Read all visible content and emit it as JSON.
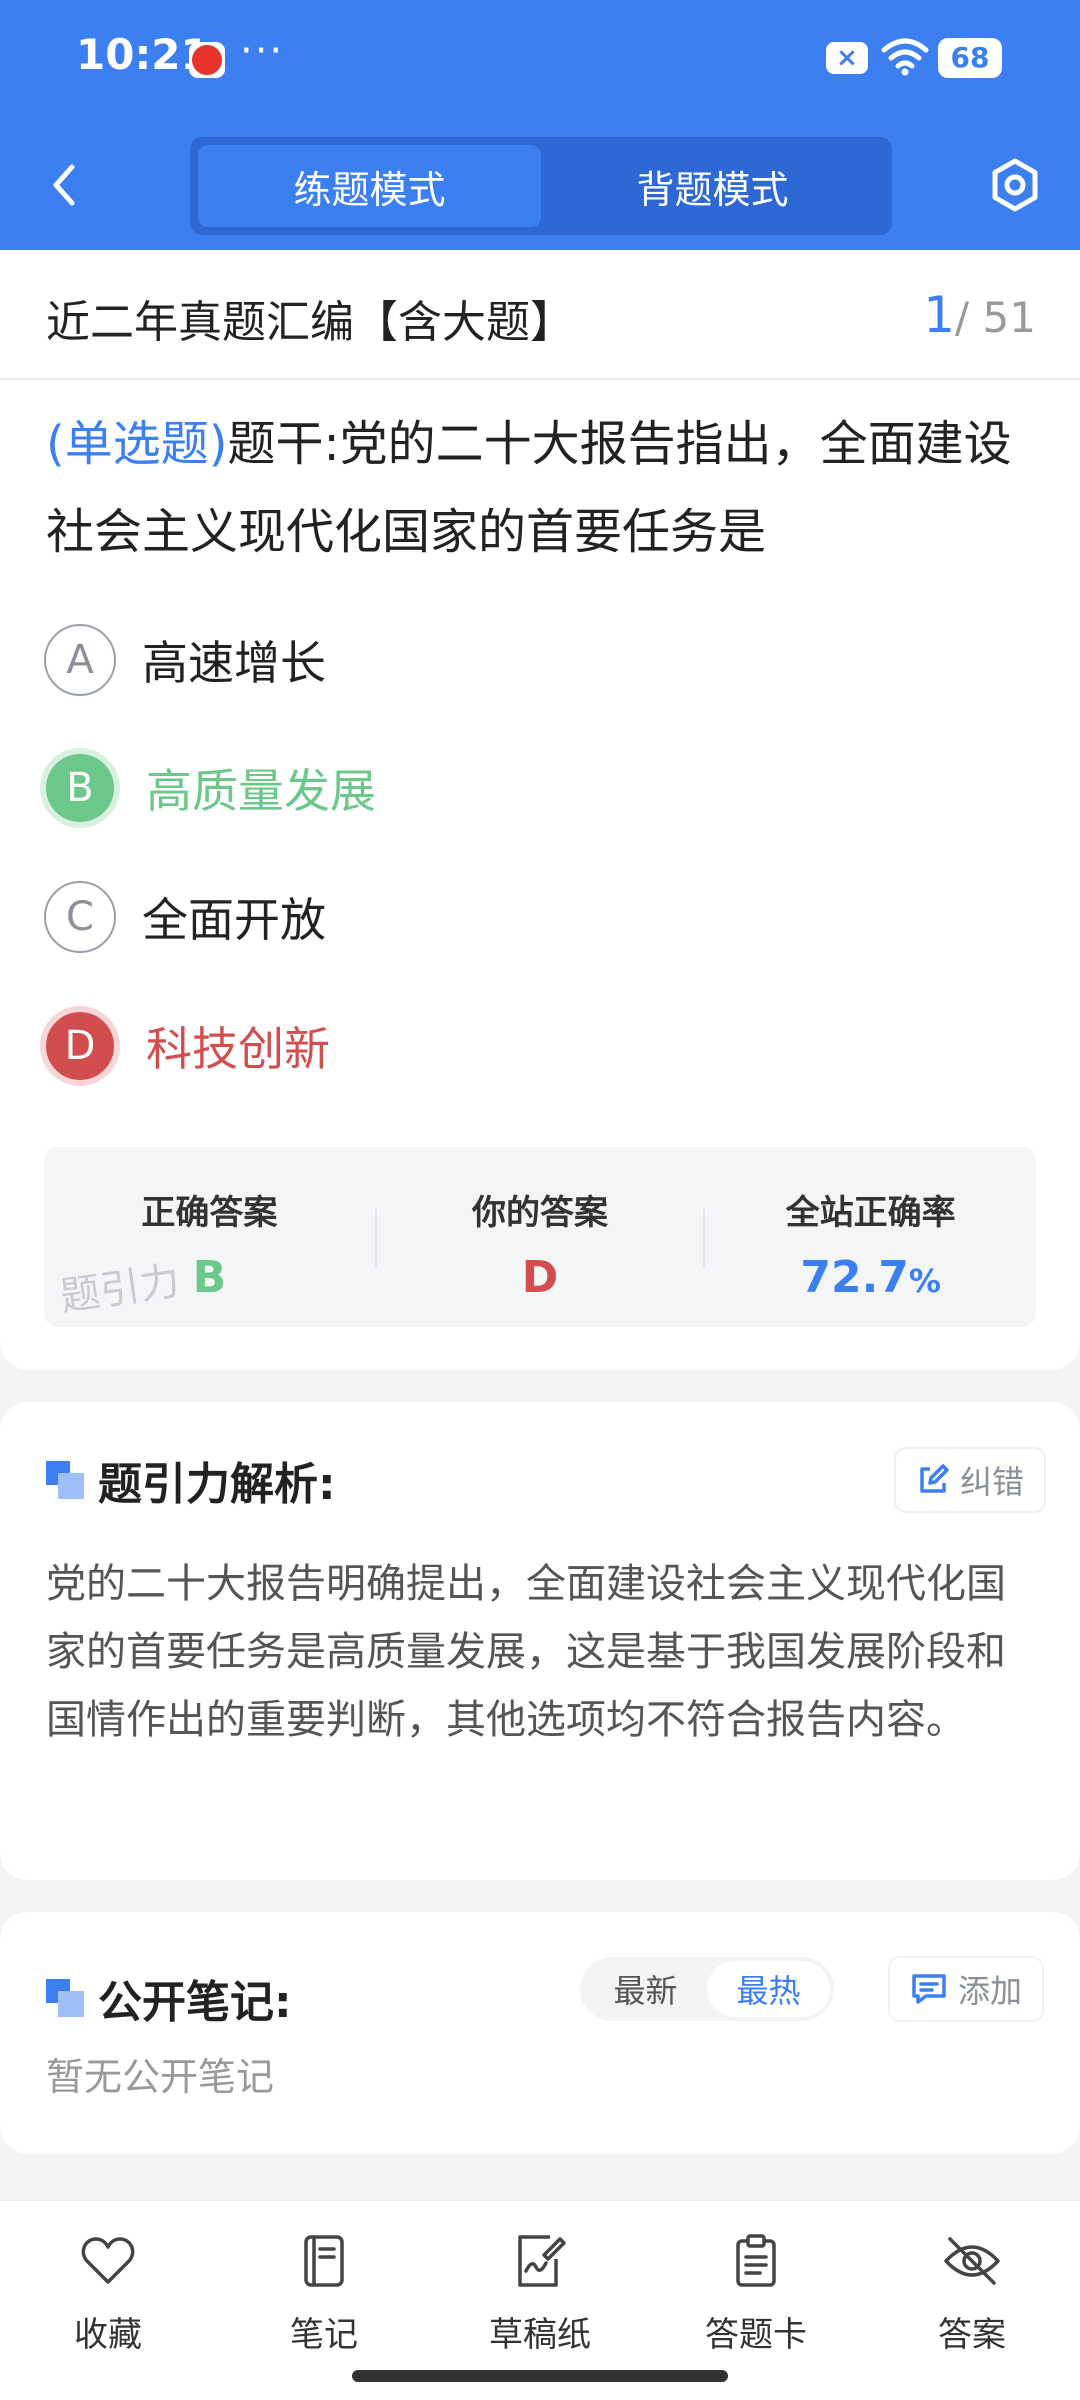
{
  "status_bar": {
    "time": "10:21",
    "more": "···",
    "battery": "68"
  },
  "header": {
    "modes": [
      "练题模式",
      "背题模式"
    ],
    "active_mode": "练题模式"
  },
  "exam": {
    "title": "近二年真题汇编【含大题】",
    "current": "1",
    "total": "/ 51"
  },
  "question": {
    "type": "(单选题)",
    "stem": "题干:党的二十大报告指出，全面建设社会主义现代化国家的首要任务是",
    "options": [
      {
        "letter": "A",
        "text": "高速增长",
        "state": "normal"
      },
      {
        "letter": "B",
        "text": "高质量发展",
        "state": "correct"
      },
      {
        "letter": "C",
        "text": "全面开放",
        "state": "normal"
      },
      {
        "letter": "D",
        "text": "科技创新",
        "state": "wrong"
      }
    ]
  },
  "result": {
    "correct_label": "正确答案",
    "correct_value": "B",
    "yours_label": "你的答案",
    "yours_value": "D",
    "rate_label": "全站正确率",
    "rate_value": "72.7",
    "rate_unit": "%",
    "watermark": "题引力"
  },
  "analysis": {
    "title": "题引力解析:",
    "report_button": "纠错",
    "text": "党的二十大报告明确提出，全面建设社会主义现代化国家的首要任务是高质量发展，这是基于我国发展阶段和国情作出的重要判断，其他选项均不符合报告内容。"
  },
  "notes": {
    "title": "公开笔记:",
    "sort_options": [
      "最新",
      "最热"
    ],
    "active_sort": "最热",
    "add_button": "添加",
    "empty_text": "暂无公开笔记"
  },
  "bottom_nav": [
    "收藏",
    "笔记",
    "草稿纸",
    "答题卡",
    "答案"
  ],
  "colors": {
    "primary": "#3b7ff1",
    "correct": "#6cc78a",
    "wrong": "#d24e4e"
  }
}
